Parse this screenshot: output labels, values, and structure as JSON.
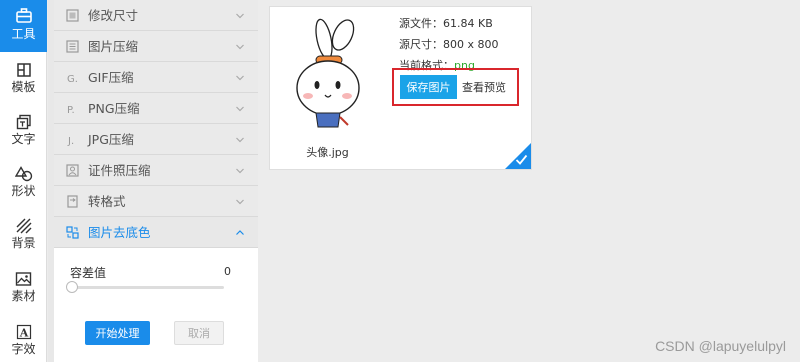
{
  "rail": {
    "items": [
      {
        "label": "工具",
        "icon": "toolbox-icon",
        "active": true
      },
      {
        "label": "模板",
        "icon": "template-icon"
      },
      {
        "label": "文字",
        "icon": "text-icon"
      },
      {
        "label": "形状",
        "icon": "shape-icon"
      },
      {
        "label": "背景",
        "icon": "background-icon"
      },
      {
        "label": "素材",
        "icon": "image-asset-icon"
      },
      {
        "label": "字效",
        "icon": "text-effect-icon"
      }
    ]
  },
  "menu": {
    "items": [
      {
        "label": "修改尺寸",
        "icon": "resize-icon"
      },
      {
        "label": "图片压缩",
        "icon": "image-compress-icon"
      },
      {
        "label": "GIF压缩",
        "icon": "gif-icon"
      },
      {
        "label": "PNG压缩",
        "icon": "png-icon"
      },
      {
        "label": "JPG压缩",
        "icon": "jpg-icon"
      },
      {
        "label": "证件照压缩",
        "icon": "id-photo-icon"
      },
      {
        "label": "转格式",
        "icon": "convert-format-icon"
      },
      {
        "label": "图片去底色",
        "icon": "remove-background-icon",
        "open": true
      }
    ]
  },
  "tolerance": {
    "label": "容差值",
    "value": "0",
    "start_label": "开始处理",
    "cancel_label": "取消"
  },
  "card": {
    "filename": "头像.jpg",
    "source_file": "源文件：61.84 KB",
    "source_size": "源尺寸：800 x 800",
    "format_label": "当前格式：",
    "format_value": "png",
    "save_label": "保存图片",
    "preview_label": "查看预览"
  },
  "watermark": "CSDN @lapuyelulpyl",
  "colors": {
    "accent": "#1a8cea",
    "highlight_box": "#d9262c",
    "format_green": "#2eaa2e"
  }
}
